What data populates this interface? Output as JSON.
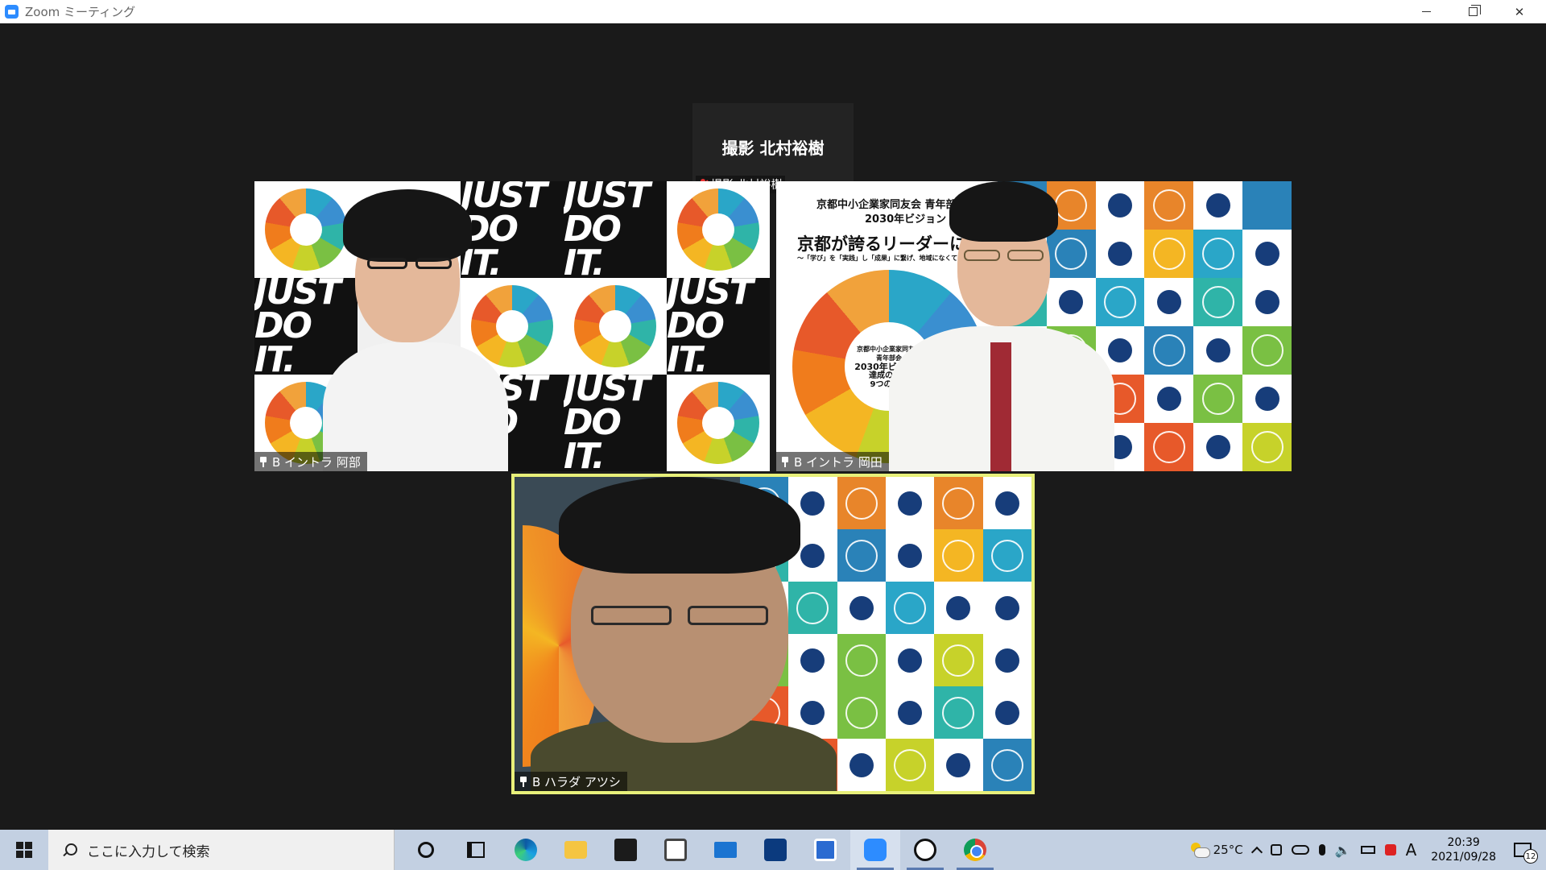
{
  "window": {
    "title": "Zoom ミーティング"
  },
  "active_speaker_mini": {
    "display_name": "撮影 北村裕樹",
    "label": "撮影 北村裕樹"
  },
  "participants": [
    {
      "label": "B イントラ 阿部"
    },
    {
      "label": "B イントラ 岡田"
    },
    {
      "label": "B ハラダ アツシ"
    }
  ],
  "backdrop": {
    "slogan": "JUST DO IT.",
    "poster_org": "京都中小企業家同友会 青年部会",
    "poster_vision": "2030年ビジョン",
    "poster_title": "京都が誇るリーダーになろう",
    "poster_subtitle": "〜「学び」を「実践」し「成果」に繋げ、地域になくてはならない経営者へ〜",
    "wheel_center_1": "京都中小企業家同友会",
    "wheel_center_2": "青年部会",
    "wheel_center_3": "2030年ビジョン",
    "wheel_center_4": "達成の為の",
    "wheel_center_5": "9つの指標"
  },
  "taskbar": {
    "search_placeholder": "ここに入力して検索",
    "apps": [
      "cortana",
      "task-view",
      "edge",
      "file-explorer",
      "store",
      "photos",
      "mail",
      "app",
      "app",
      "zoom",
      "app",
      "chrome"
    ],
    "weather_temp": "25°C",
    "ime_mode": "A",
    "time": "20:39",
    "date": "2021/09/28",
    "notification_count": "12"
  },
  "colors": {
    "meeting_bg": "#1a1a1a",
    "active_border": "#e8f07a",
    "taskbar_bg": "#c3d0e2",
    "zoom_blue": "#2d8cff"
  }
}
